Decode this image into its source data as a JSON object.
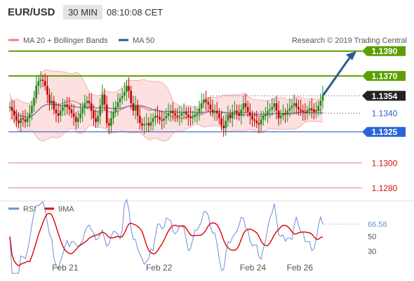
{
  "header": {
    "symbol": "EUR/USD",
    "timeframe": "30 MIN",
    "time": "08:10:08 CET"
  },
  "legend": {
    "main": [
      {
        "label": "MA 20 + Bollinger Bands",
        "color": "#f08080"
      },
      {
        "label": "MA 50",
        "color": "#2c5a8c"
      }
    ],
    "copyright": "Research © 2019 Trading Central",
    "rsi": [
      {
        "label": "RSI",
        "color": "#6a8fd8"
      },
      {
        "label": "9MA",
        "color": "#e00000"
      }
    ]
  },
  "colors": {
    "resistance": "#5aa000",
    "support": "#e08080",
    "pivot": "#2b63d8",
    "arrow": "#2c5a8c",
    "candle_up": "#1a8a1a",
    "candle_down": "#c00000"
  },
  "chart_data": [
    {
      "type": "candlestick",
      "ylim": [
        1.127,
        1.14
      ],
      "x_labels": [
        {
          "label": "Feb 21",
          "x": 29
        },
        {
          "label": "Feb 22",
          "x": 77
        },
        {
          "label": "Feb 24",
          "x": 125
        },
        {
          "label": "Feb 26",
          "x": 149
        }
      ],
      "x_max": 160,
      "close_series": [
        1.1345,
        1.1342,
        1.1338,
        1.1334,
        1.1332,
        1.1336,
        1.1335,
        1.1333,
        1.1336,
        1.134,
        1.1346,
        1.1352,
        1.1362,
        1.1366,
        1.1367,
        1.1366,
        1.1362,
        1.1355,
        1.1348,
        1.135,
        1.1343,
        1.134,
        1.1338,
        1.1342,
        1.1345,
        1.1347,
        1.1345,
        1.1343,
        1.134,
        1.1337,
        1.1333,
        1.1336,
        1.134,
        1.1344,
        1.1348,
        1.135,
        1.1348,
        1.1342,
        1.1336,
        1.1333,
        1.1338,
        1.1346,
        1.1355,
        1.1347,
        1.1332,
        1.133,
        1.1336,
        1.1341,
        1.1345,
        1.1349,
        1.1352,
        1.1354,
        1.1357,
        1.1362,
        1.1358,
        1.1348,
        1.1342,
        1.1346,
        1.1338,
        1.1332,
        1.133,
        1.1331,
        1.1332,
        1.133,
        1.1333,
        1.1336,
        1.1338,
        1.1337,
        1.1335,
        1.1334,
        1.1336,
        1.1338,
        1.134,
        1.1342,
        1.134,
        1.1338,
        1.1337,
        1.1338,
        1.134,
        1.1341,
        1.1339,
        1.1337,
        1.1336,
        1.1337,
        1.1339,
        1.134,
        1.1344,
        1.1348,
        1.1351,
        1.1349,
        1.1347,
        1.1343,
        1.1341,
        1.1342,
        1.134,
        1.1336,
        1.133,
        1.1328,
        1.1334,
        1.1339,
        1.1336,
        1.1341,
        1.1342,
        1.134,
        1.1338,
        1.1343,
        1.1348,
        1.1345,
        1.1341,
        1.1338,
        1.1335,
        1.1334,
        1.1332,
        1.1331,
        1.1335,
        1.1338,
        1.1339,
        1.1342,
        1.1343,
        1.1345,
        1.1348,
        1.1342,
        1.1336,
        1.1338,
        1.134,
        1.1339,
        1.1342,
        1.1344,
        1.1346,
        1.1348,
        1.1345,
        1.1343,
        1.1342,
        1.1341,
        1.134,
        1.1342,
        1.1344,
        1.1343,
        1.1341,
        1.1342,
        1.1346,
        1.135,
        1.1354
      ],
      "series": [
        {
          "name": "MA 20 + Bollinger Bands"
        },
        {
          "name": "MA 50"
        }
      ],
      "levels": [
        {
          "value": 1.139,
          "label": "1.1390",
          "role": "resistance"
        },
        {
          "value": 1.137,
          "label": "1.1370",
          "role": "resistance"
        },
        {
          "value": 1.1354,
          "label": "1.1354",
          "role": "last"
        },
        {
          "value": 1.134,
          "label": "1.1340",
          "role": "pivot-dotted"
        },
        {
          "value": 1.1325,
          "label": "1.1325",
          "role": "pivot"
        },
        {
          "value": 1.13,
          "label": "1.1300",
          "role": "support"
        },
        {
          "value": 1.128,
          "label": "1.1280",
          "role": "support"
        }
      ],
      "forecast": {
        "from": 1.1354,
        "to": 1.139
      }
    },
    {
      "type": "line",
      "ylim": [
        20,
        80
      ],
      "y_ticks": [
        30,
        50
      ],
      "last_value_label": "66.58",
      "series": [
        {
          "name": "RSI"
        },
        {
          "name": "9MA"
        }
      ]
    }
  ]
}
